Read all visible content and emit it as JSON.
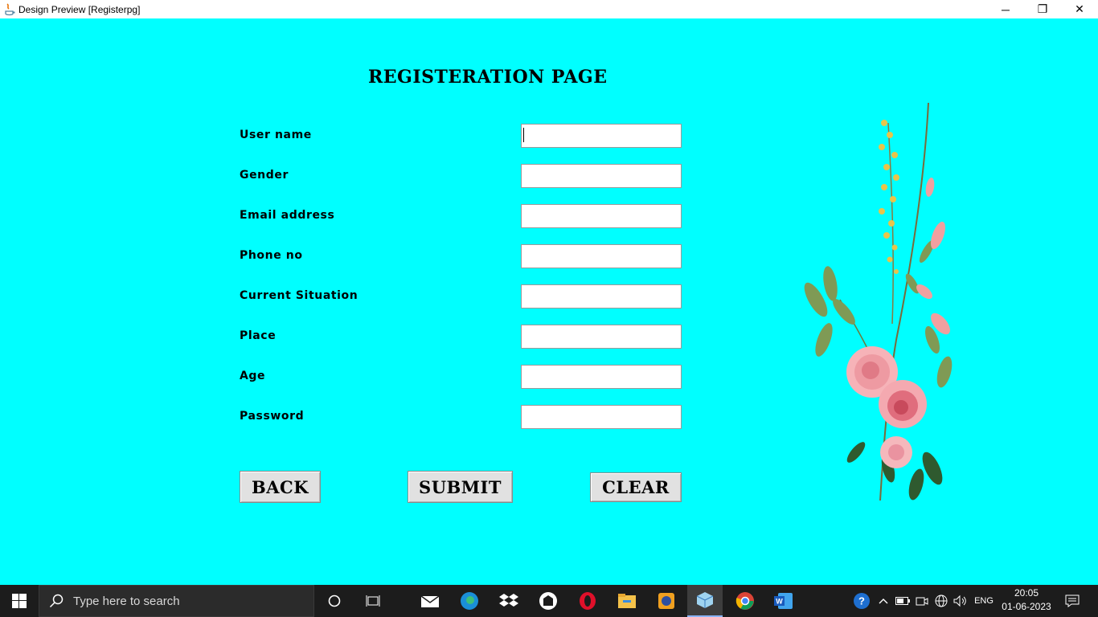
{
  "window": {
    "title": "Design Preview [Registerpg]",
    "controls": {
      "minimize": "─",
      "restore": "❐",
      "close": "✕"
    }
  },
  "form": {
    "title": "REGISTERATION PAGE",
    "fields": [
      {
        "label": "User name",
        "value": ""
      },
      {
        "label": "Gender",
        "value": ""
      },
      {
        "label": "Email address",
        "value": ""
      },
      {
        "label": "Phone no",
        "value": ""
      },
      {
        "label": "Current Situation",
        "value": ""
      },
      {
        "label": "Place",
        "value": ""
      },
      {
        "label": "Age",
        "value": ""
      },
      {
        "label": "Password",
        "value": ""
      }
    ],
    "buttons": {
      "back": "BACK",
      "submit": "SUBMIT",
      "clear": "CLEAR"
    }
  },
  "taskbar": {
    "search_placeholder": "Type here to search",
    "language": "ENG",
    "time": "20:05",
    "date": "01-06-2023",
    "apps": [
      "cortana-icon",
      "task-view-icon",
      "mail-icon",
      "edge-icon",
      "dropbox-icon",
      "app-icon",
      "opera-icon",
      "file-explorer-icon",
      "media-icon",
      "java-app-icon",
      "chrome-icon",
      "word-icon"
    ]
  },
  "colors": {
    "background": "#00ffff",
    "taskbar": "#1c1c1c",
    "button": "#e1e1e1"
  }
}
